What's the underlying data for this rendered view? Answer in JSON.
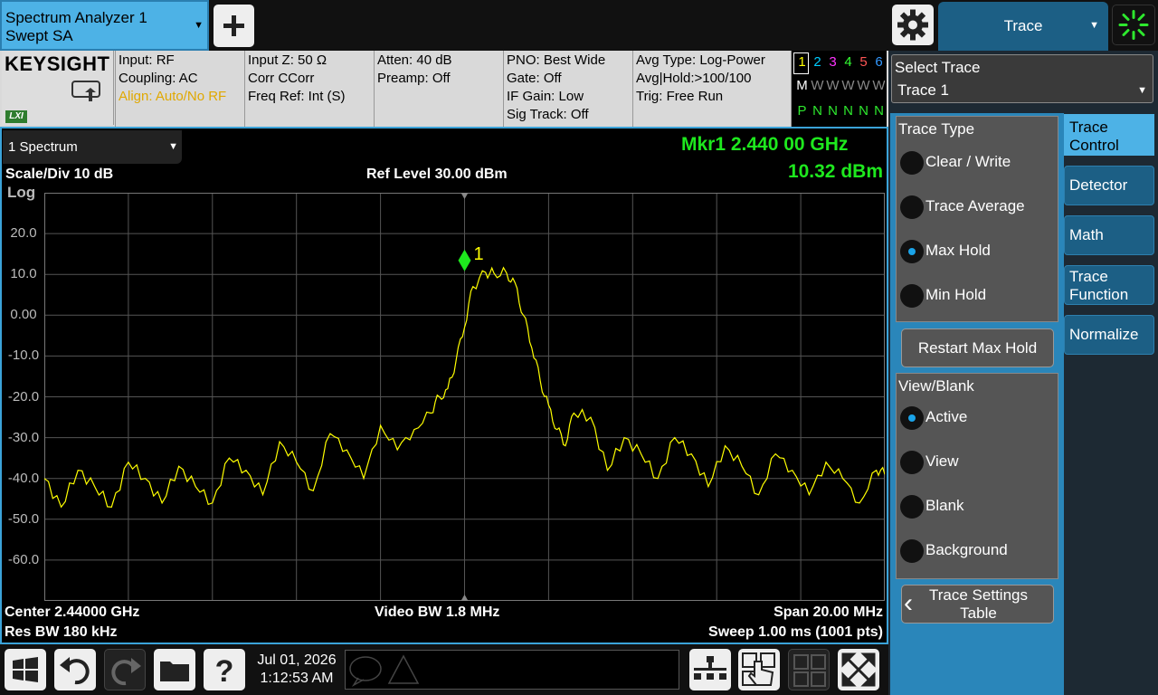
{
  "app_tab": {
    "line1": "Spectrum Analyzer 1",
    "line2": "Swept SA"
  },
  "menu_tab": {
    "label": "Trace"
  },
  "info": {
    "brand": "KEYSIGHT",
    "lxi": "LXI",
    "col1": [
      "Input: RF",
      "Coupling: AC",
      "Align: Auto/No RF"
    ],
    "col2": [
      "Input Z: 50 Ω",
      "Corr CCorr",
      "Freq Ref: Int (S)"
    ],
    "col3": [
      "Atten: 40 dB",
      "Preamp: Off"
    ],
    "col4": [
      "PNO: Best Wide",
      "Gate: Off",
      "IF Gain: Low",
      "Sig Track: Off"
    ],
    "col5": [
      "Avg Type: Log-Power",
      "Avg|Hold:>100/100",
      "Trig: Free Run"
    ],
    "trace_numbers": [
      "1",
      "2",
      "3",
      "4",
      "5",
      "6"
    ],
    "trace_modes": [
      "M",
      "W",
      "W",
      "W",
      "W",
      "W"
    ],
    "trace_det": [
      "P",
      "N",
      "N",
      "N",
      "N",
      "N"
    ],
    "trace_colors": [
      "#ffff00",
      "#00ccff",
      "#ff33ff",
      "#33ff33",
      "#ff5555",
      "#3399ff"
    ]
  },
  "plot": {
    "window_select": "1 Spectrum",
    "marker_freq": "Mkr1  2.440 00 GHz",
    "marker_amp": "10.32 dBm",
    "scale": "Scale/Div 10 dB",
    "ref_level": "Ref Level 30.00 dBm",
    "log": "Log",
    "y_ticks": [
      "20.0",
      "10.0",
      "0.00",
      "-10.0",
      "-20.0",
      "-30.0",
      "-40.0",
      "-50.0",
      "-60.0"
    ],
    "center": "Center 2.44000 GHz",
    "res_bw": "Res BW 180 kHz",
    "video_bw": "Video BW 1.8 MHz",
    "span": "Span 20.00 MHz",
    "sweep": "Sweep 1.00 ms (1001 pts)",
    "marker_label": "1"
  },
  "chart_data": {
    "type": "line",
    "x_unit": "MHz offset from center",
    "ylim": [
      -70,
      30
    ],
    "xlim": [
      -10,
      10
    ],
    "grid": true,
    "series": [
      {
        "color": "#ffff00",
        "points": [
          [
            -10,
            -40
          ],
          [
            -9.6,
            -47
          ],
          [
            -9.2,
            -38
          ],
          [
            -8.8,
            -42
          ],
          [
            -8.4,
            -47
          ],
          [
            -8,
            -36
          ],
          [
            -7.6,
            -40
          ],
          [
            -7.2,
            -46
          ],
          [
            -6.8,
            -37
          ],
          [
            -6.4,
            -42
          ],
          [
            -6,
            -46
          ],
          [
            -5.6,
            -35
          ],
          [
            -5.2,
            -38
          ],
          [
            -4.8,
            -44
          ],
          [
            -4.4,
            -31
          ],
          [
            -4,
            -36
          ],
          [
            -3.6,
            -43
          ],
          [
            -3.2,
            -29
          ],
          [
            -2.8,
            -33
          ],
          [
            -2.4,
            -40
          ],
          [
            -2,
            -27
          ],
          [
            -1.6,
            -33
          ],
          [
            -1.2,
            -28
          ],
          [
            -0.8,
            -24
          ],
          [
            -0.6,
            -20
          ],
          [
            -0.4,
            -18
          ],
          [
            -0.2,
            -11
          ],
          [
            0,
            -3
          ],
          [
            0.2,
            7
          ],
          [
            0.5,
            10.5
          ],
          [
            0.7,
            10.3
          ],
          [
            1,
            10.3
          ],
          [
            1.2,
            8
          ],
          [
            1.4,
            0
          ],
          [
            1.6,
            -8
          ],
          [
            1.8,
            -16
          ],
          [
            2,
            -22
          ],
          [
            2.2,
            -28
          ],
          [
            2.4,
            -32
          ],
          [
            2.6,
            -24
          ],
          [
            3,
            -25
          ],
          [
            3.4,
            -38
          ],
          [
            3.8,
            -30
          ],
          [
            4.2,
            -34
          ],
          [
            4.6,
            -40
          ],
          [
            5,
            -30
          ],
          [
            5.4,
            -34
          ],
          [
            5.8,
            -42
          ],
          [
            6.2,
            -32
          ],
          [
            6.6,
            -37
          ],
          [
            7,
            -44
          ],
          [
            7.4,
            -34
          ],
          [
            7.8,
            -38
          ],
          [
            8.2,
            -44
          ],
          [
            8.6,
            -36
          ],
          [
            9,
            -40
          ],
          [
            9.4,
            -46
          ],
          [
            9.8,
            -38
          ],
          [
            10,
            -39
          ]
        ]
      }
    ],
    "marker": {
      "x": 0.0,
      "y": 10.32
    }
  },
  "date": {
    "line1": "Jul 01, 2026",
    "line2": "1:12:53 AM"
  },
  "panel": {
    "select_trace_label": "Select Trace",
    "select_trace_value": "Trace 1",
    "trace_type_title": "Trace Type",
    "trace_types": [
      "Clear / Write",
      "Trace Average",
      "Max Hold",
      "Min Hold"
    ],
    "trace_type_selected": 2,
    "restart_btn": "Restart Max Hold",
    "view_title": "View/Blank",
    "views": [
      "Active",
      "View",
      "Blank",
      "Background"
    ],
    "view_selected": 0,
    "settings_btn_l1": "Trace Settings",
    "settings_btn_l2": "Table",
    "side_tabs": [
      {
        "l1": "Trace",
        "l2": "Control"
      },
      {
        "l1": "Detector",
        "l2": ""
      },
      {
        "l1": "Math",
        "l2": ""
      },
      {
        "l1": "Trace",
        "l2": "Function"
      },
      {
        "l1": "Normalize",
        "l2": ""
      }
    ]
  }
}
